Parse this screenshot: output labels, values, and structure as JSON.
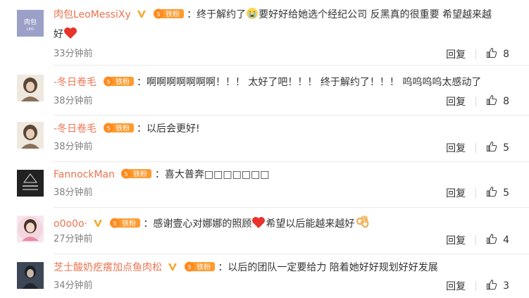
{
  "colors": {
    "username": "#eb7350",
    "text": "#333333",
    "time": "#808080",
    "heart": "#e8322c"
  },
  "actions": {
    "reply_label": "回复"
  },
  "comments": [
    {
      "username": "肉包LeoMessiXy",
      "avatar_text": "肉包",
      "avatar_subtext": "LEO",
      "verified": true,
      "fan_badge": "铁粉",
      "text_part1": "：终于解约了",
      "text_part2": "要好好给她选个经纪公司 反黑真的很重要 希望越来越",
      "text_line2": "好",
      "time": "33分钟前",
      "likes": "8"
    },
    {
      "username": "-冬日卷毛",
      "verified": false,
      "fan_badge": "铁粉",
      "text": "：啊啊啊啊啊啊啊！！！ 太好了吧！！！ 终于解约了！！！ 呜呜呜呜太感动了",
      "time": "38分钟前",
      "likes": "8"
    },
    {
      "username": "-冬日卷毛",
      "verified": false,
      "fan_badge": "铁粉",
      "text": "：以后会更好!",
      "time": "38分钟前",
      "likes": "5"
    },
    {
      "username": "FannockMan",
      "verified": false,
      "fan_badge": "铁粉",
      "text": "：喜大普奔□□□□□□□",
      "time": "38分钟前",
      "likes": "5"
    },
    {
      "username": "o0o0o·",
      "verified": true,
      "fan_badge": "铁粉",
      "text_part1": "：感谢壹心对娜娜的照顾",
      "text_part2": "希望以后能越来越好",
      "time": "27分钟前",
      "likes": "4"
    },
    {
      "username": "芝士酸奶疙瘩加点鱼肉松",
      "verified": true,
      "fan_badge": "铁粉",
      "text": "：以后的团队一定要给力 陪着她好好规划好好发展",
      "time": "34分钟前",
      "likes": "3"
    }
  ]
}
